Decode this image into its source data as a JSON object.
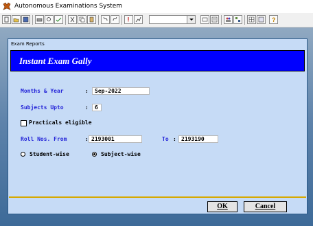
{
  "app": {
    "title": "Autonomous Examinations System"
  },
  "dialog": {
    "window_title": "Exam Reports",
    "banner_title": "Instant Exam Gally",
    "months_year_label": "Months & Year",
    "months_year_value": "Sep-2022",
    "subjects_upto_label": "Subjects Upto",
    "subjects_upto_value": "6",
    "practicals_label": "Practicals eligible",
    "practicals_checked": false,
    "roll_from_label": "Roll Nos. From",
    "roll_from_value": "2193001",
    "roll_to_label": "To",
    "roll_to_value": "2193190",
    "student_wise_label": "Student-wise",
    "subject_wise_label": "Subject-wise",
    "selected_mode": "subject-wise",
    "ok_label": "OK",
    "cancel_label": "Cancel"
  },
  "colors": {
    "banner": "#0000ff",
    "label_blue": "#2424d8",
    "panel": "#c6dbf6",
    "divider": "#d6a800"
  }
}
